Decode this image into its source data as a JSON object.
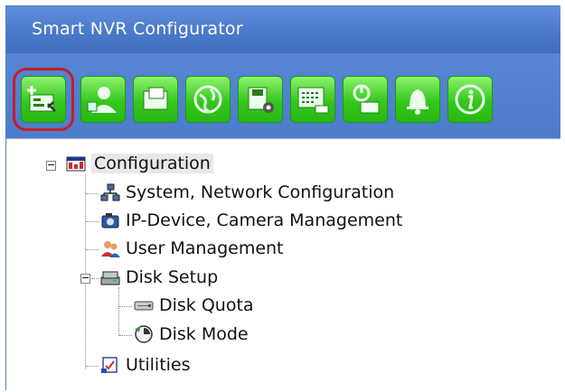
{
  "window": {
    "title": "Smart NVR Configurator"
  },
  "toolbar": {
    "buttons": [
      {
        "icon": "add-configuration-icon",
        "selected": true
      },
      {
        "icon": "user-icon"
      },
      {
        "icon": "folder-icon"
      },
      {
        "icon": "globe-icon"
      },
      {
        "icon": "disk-settings-icon"
      },
      {
        "icon": "keyboard-icon"
      },
      {
        "icon": "power-disk-icon"
      },
      {
        "icon": "bell-icon"
      },
      {
        "icon": "info-icon"
      }
    ]
  },
  "tree": {
    "root": {
      "label": "Configuration",
      "expander": "−"
    },
    "items": [
      {
        "label": "System, Network Configuration",
        "icon": "network-icon"
      },
      {
        "label": "IP-Device, Camera Management",
        "icon": "camera-icon"
      },
      {
        "label": "User Management",
        "icon": "users-icon"
      },
      {
        "label": "Disk Setup",
        "icon": "disk-setup-icon",
        "expander": "−"
      },
      {
        "label": "Disk Quota",
        "icon": "disk-quota-icon"
      },
      {
        "label": "Disk Mode",
        "icon": "disk-mode-icon"
      },
      {
        "label": "Utilities",
        "icon": "utilities-icon"
      }
    ]
  },
  "colors": {
    "selection_frame": "#c81e28",
    "toolbar_green": "#34c81c",
    "title_blue": "#4878c8"
  }
}
